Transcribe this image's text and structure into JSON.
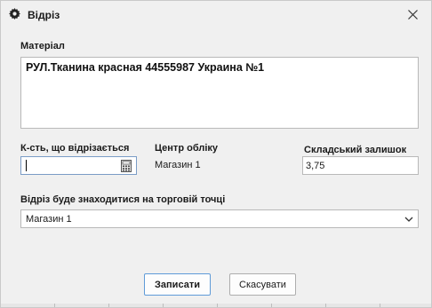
{
  "window": {
    "title": "Відріз",
    "icon": "gear-icon",
    "close_icon": "close-icon"
  },
  "material": {
    "label": "Матеріал",
    "value": "РУЛ.Тканина красная 44555987 Украина №1"
  },
  "quantity": {
    "label": "К-сть, що відрізається",
    "value": "",
    "icon": "calculator-icon"
  },
  "accounting_center": {
    "label": "Центр обліку",
    "value": "Магазин 1"
  },
  "stock_balance": {
    "label": "Складський залишок",
    "value": "3,75"
  },
  "retail_point": {
    "label": "Відріз буде знаходитися на торговій точці",
    "selected": "Магазин 1"
  },
  "buttons": {
    "save": "Записати",
    "cancel": "Скасувати"
  },
  "colors": {
    "window_bg": "#f0f0f0",
    "focus_border": "#7a9cc6",
    "primary_border": "#5f9bd8"
  }
}
